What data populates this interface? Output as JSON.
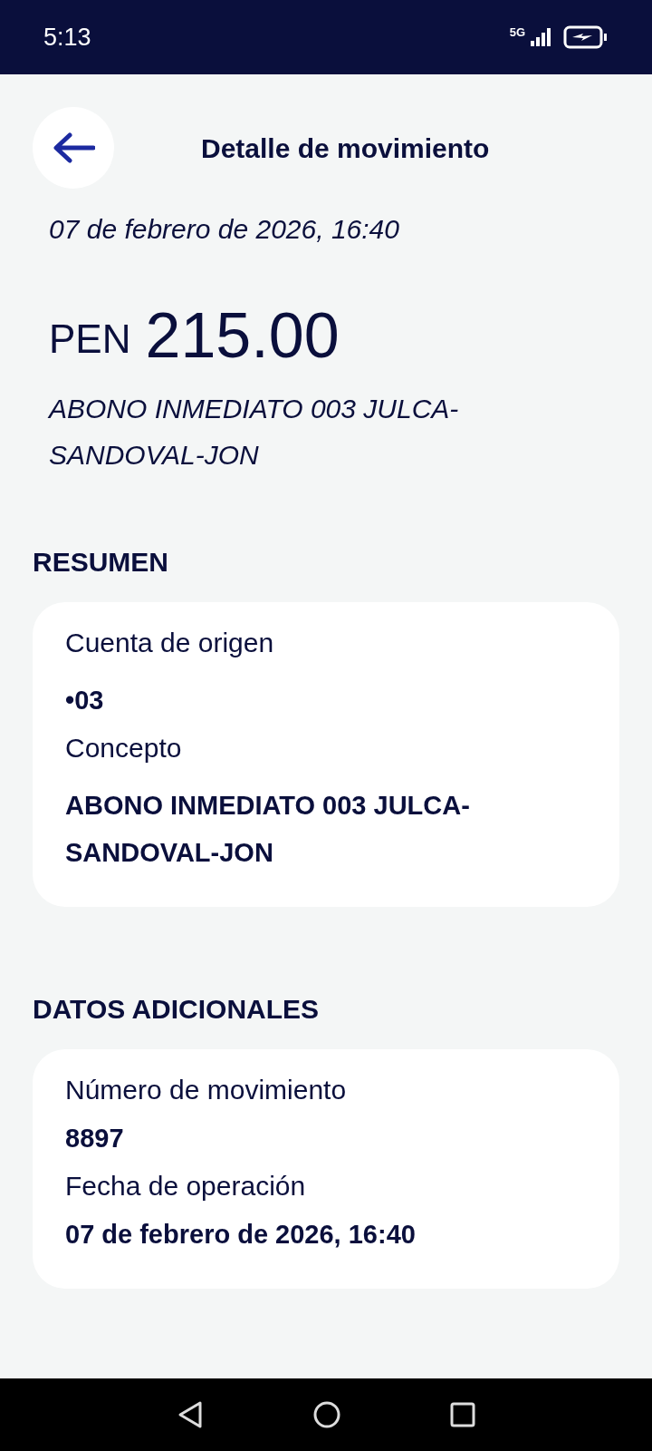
{
  "status_bar": {
    "time": "5:13",
    "network": "5G"
  },
  "header": {
    "title": "Detalle de movimiento"
  },
  "date": "07 de febrero de 2026, 16:40",
  "amount": {
    "currency": "PEN",
    "value": "215.00"
  },
  "description": "ABONO INMEDIATO 003 JULCA-SANDOVAL-JON",
  "sections": [
    {
      "title": "RESUMEN",
      "fields": [
        {
          "label": "Cuenta de origen",
          "value": "•03"
        },
        {
          "label": "Concepto",
          "value": "ABONO INMEDIATO 003 JULCA-SANDOVAL-JON"
        }
      ]
    },
    {
      "title": "DATOS ADICIONALES",
      "fields": [
        {
          "label": "Número de movimiento",
          "value": "8897"
        },
        {
          "label": "Fecha de operación",
          "value": "07 de febrero de 2026, 16:40"
        }
      ]
    }
  ]
}
